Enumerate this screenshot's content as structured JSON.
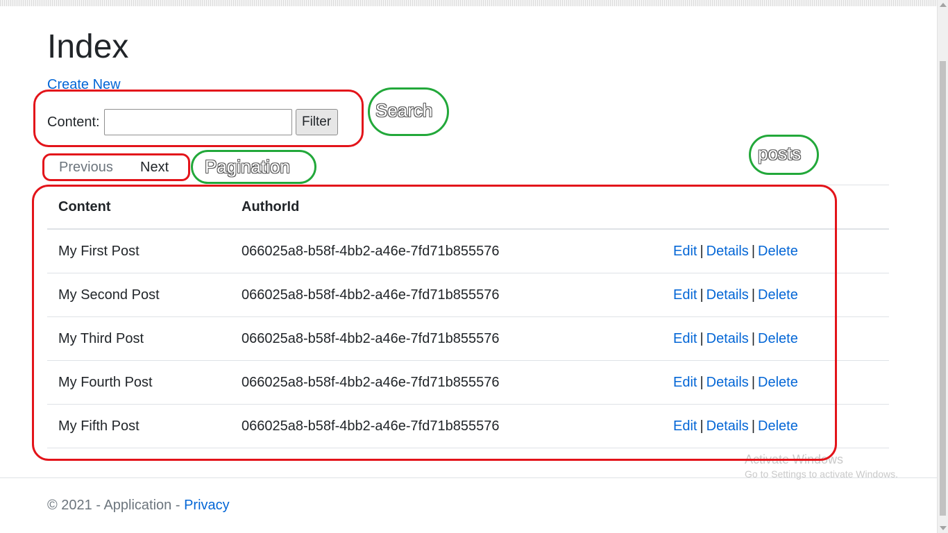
{
  "page": {
    "title": "Index",
    "create_new": "Create New"
  },
  "filter": {
    "label": "Content:",
    "value": "",
    "button": "Filter"
  },
  "pagination": {
    "previous": "Previous",
    "next": "Next"
  },
  "table": {
    "headers": [
      "Content",
      "AuthorId",
      ""
    ],
    "rows": [
      {
        "content": "My First Post",
        "author_id": "066025a8-b58f-4bb2-a46e-7fd71b855576"
      },
      {
        "content": "My Second Post",
        "author_id": "066025a8-b58f-4bb2-a46e-7fd71b855576"
      },
      {
        "content": "My Third Post",
        "author_id": "066025a8-b58f-4bb2-a46e-7fd71b855576"
      },
      {
        "content": "My Fourth Post",
        "author_id": "066025a8-b58f-4bb2-a46e-7fd71b855576"
      },
      {
        "content": "My Fifth Post",
        "author_id": "066025a8-b58f-4bb2-a46e-7fd71b855576"
      }
    ],
    "actions": {
      "edit": "Edit",
      "details": "Details",
      "delete": "Delete",
      "separator": "|"
    }
  },
  "footer": {
    "text": "© 2021 - Application - ",
    "privacy": "Privacy"
  },
  "watermark": {
    "title": "Activate Windows",
    "subtitle": "Go to Settings to activate Windows."
  },
  "annotations": {
    "search": "Search",
    "pagination": "Pagination",
    "posts": "posts"
  },
  "colors": {
    "link": "#0366d6",
    "annotation_red": "#e3141a",
    "annotation_green": "#22a83a"
  }
}
